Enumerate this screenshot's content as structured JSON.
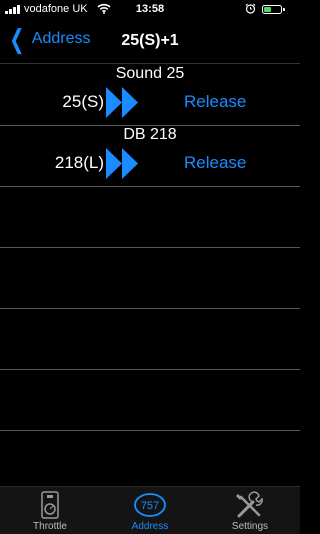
{
  "status_bar": {
    "carrier": "vodafone UK",
    "time": "13:58",
    "battery_level": 0.45,
    "battery_color": "#4cd964"
  },
  "nav": {
    "back_label": "Address",
    "title": "25(S)+1"
  },
  "locos": [
    {
      "name": "Sound 25",
      "address": "25(S)",
      "action_label": "Release",
      "icon": "fast-forward-icon"
    },
    {
      "name": "DB 218",
      "address": "218(L)",
      "action_label": "Release",
      "icon": "fast-forward-icon"
    }
  ],
  "tabs": [
    {
      "label": "Throttle",
      "icon": "throttle-icon",
      "active": false
    },
    {
      "label": "Address",
      "icon": "address-badge-icon",
      "badge": "757",
      "active": true
    },
    {
      "label": "Settings",
      "icon": "tools-icon",
      "active": false
    }
  ],
  "colors": {
    "accent": "#1a8cff",
    "background": "#000000"
  }
}
